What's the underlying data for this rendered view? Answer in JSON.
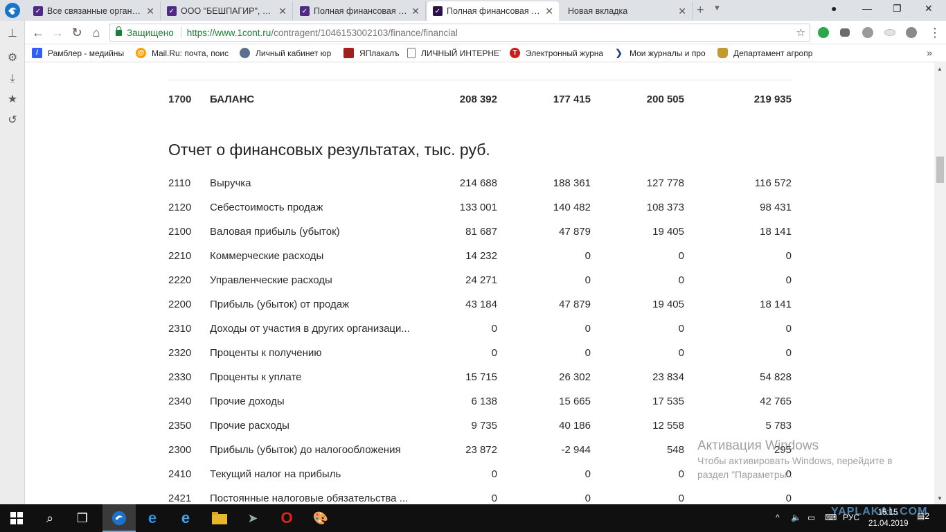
{
  "tabs": [
    {
      "title": "Все связанные организа",
      "active": false
    },
    {
      "title": "ООО \"БЕШПАГИР\", Беш",
      "active": false
    },
    {
      "title": "Полная финансовая ста",
      "active": false
    },
    {
      "title": "Полная финансовая ста",
      "active": true
    },
    {
      "title": "Новая вкладка",
      "active": false
    }
  ],
  "toolbar": {
    "secure_label": "Защищено",
    "url_host": "https://www.1cont.ru",
    "url_path": "/contragent/1046153002103/finance/financial"
  },
  "bookmarks": [
    {
      "label": "Рамблер - медийны",
      "icon": "rambler-icon",
      "color": "#315efb"
    },
    {
      "label": "Mail.Ru: почта, поис",
      "icon": "mailru-icon",
      "color": "#ff9e00"
    },
    {
      "label": "Личный кабинет юр",
      "icon": "cabinet-icon",
      "color": "#5b6f8f"
    },
    {
      "label": "ЯПлакалъ",
      "icon": "yaplakal-icon",
      "color": "#a02020"
    },
    {
      "label": "ЛИЧНЫЙ ИНТЕРНЕТ",
      "icon": "page-icon",
      "color": "#ffffff"
    },
    {
      "label": "Электронный журна",
      "icon": "journal-icon",
      "color": "#d11a1a"
    },
    {
      "label": "Мои журналы и про",
      "icon": "chevron-icon",
      "color": "#1a3c8a"
    },
    {
      "label": "Департамент агропр",
      "icon": "emblem-icon",
      "color": "#c29a2d"
    }
  ],
  "balance_row": {
    "code": "1700",
    "label": "БАЛАНС",
    "values": [
      "208 392",
      "177 415",
      "200 505",
      "219 935"
    ]
  },
  "section_title": "Отчет о финансовых результатах, тыс. руб.",
  "rows": [
    {
      "code": "2110",
      "label": "Выручка",
      "values": [
        "214 688",
        "188 361",
        "127 778",
        "116 572"
      ]
    },
    {
      "code": "2120",
      "label": "Себестоимость продаж",
      "values": [
        "133 001",
        "140 482",
        "108 373",
        "98 431"
      ]
    },
    {
      "code": "2100",
      "label": "Валовая прибыль (убыток)",
      "values": [
        "81 687",
        "47 879",
        "19 405",
        "18 141"
      ]
    },
    {
      "code": "2210",
      "label": "Коммерческие расходы",
      "values": [
        "14 232",
        "0",
        "0",
        "0"
      ]
    },
    {
      "code": "2220",
      "label": "Управленческие расходы",
      "values": [
        "24 271",
        "0",
        "0",
        "0"
      ]
    },
    {
      "code": "2200",
      "label": "Прибыль (убыток) от продаж",
      "values": [
        "43 184",
        "47 879",
        "19 405",
        "18 141"
      ]
    },
    {
      "code": "2310",
      "label": "Доходы от участия в других организаци...",
      "values": [
        "0",
        "0",
        "0",
        "0"
      ]
    },
    {
      "code": "2320",
      "label": "Проценты к получению",
      "values": [
        "0",
        "0",
        "0",
        "0"
      ]
    },
    {
      "code": "2330",
      "label": "Проценты к уплате",
      "values": [
        "15 715",
        "26 302",
        "23 834",
        "54 828"
      ]
    },
    {
      "code": "2340",
      "label": "Прочие доходы",
      "values": [
        "6 138",
        "15 665",
        "17 535",
        "42 765"
      ]
    },
    {
      "code": "2350",
      "label": "Прочие расходы",
      "values": [
        "9 735",
        "40 186",
        "12 558",
        "5 783"
      ]
    },
    {
      "code": "2300",
      "label": "Прибыль (убыток) до налогообложения",
      "values": [
        "23 872",
        "-2 944",
        "548",
        "295"
      ]
    },
    {
      "code": "2410",
      "label": "Текущий налог на прибыль",
      "values": [
        "0",
        "0",
        "0",
        "0"
      ]
    },
    {
      "code": "2421",
      "label": "Постоянные налоговые обязательства ...",
      "values": [
        "0",
        "0",
        "0",
        "0"
      ]
    }
  ],
  "watermark": {
    "title": "Активация Windows",
    "line1": "Чтобы активировать Windows, перейдите в",
    "line2": "раздел \"Параметры\"."
  },
  "taskbar": {
    "lang": "РУС",
    "time": "15:15",
    "date": "21.04.2019",
    "notifications": "2",
    "site_watermark": "YAPLAKAL.COM"
  }
}
